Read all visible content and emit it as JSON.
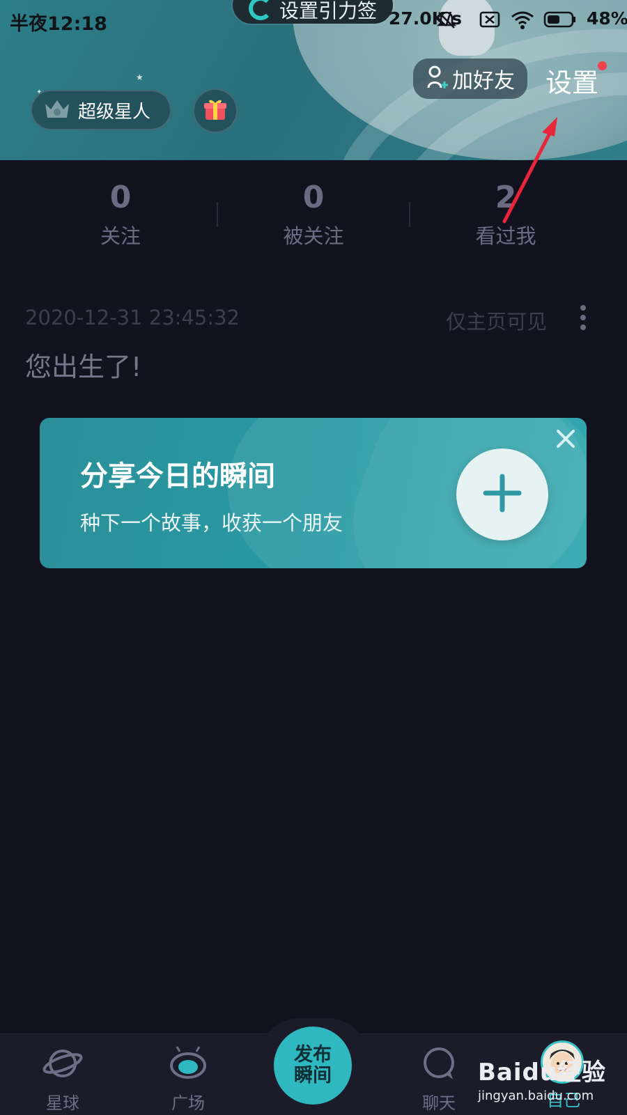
{
  "status_bar": {
    "time": "半夜12:18",
    "speed": "•••27.0K/s",
    "battery": "48%"
  },
  "notification": {
    "text": "设置引力签"
  },
  "header": {
    "vip_label": "超级星人",
    "add_friend_label": "加好友",
    "settings_label": "设置"
  },
  "stats": [
    {
      "value": "0",
      "label": "关注"
    },
    {
      "value": "0",
      "label": "被关注"
    },
    {
      "value": "2",
      "label": "看过我"
    }
  ],
  "post": {
    "timestamp": "2020-12-31 23:45:32",
    "visibility": "仅主页可见",
    "text": "您出生了!"
  },
  "share_card": {
    "title": "分享今日的瞬间",
    "subtitle": "种下一个故事，收获一个朋友"
  },
  "bottom_nav": {
    "items": [
      {
        "label": "星球"
      },
      {
        "label": "广场"
      },
      {
        "label": "聊天"
      },
      {
        "label": "自己"
      }
    ],
    "publish_label_line1": "发布",
    "publish_label_line2": "瞬间",
    "active_index": 3
  },
  "watermark": {
    "logo": "Baidu经验",
    "url": "jingyan.baidu.com"
  },
  "colors": {
    "background": "#13131f",
    "accent": "#2fb8bf",
    "notification_dot": "#f0424d",
    "annotation_arrow": "#e8263a"
  }
}
